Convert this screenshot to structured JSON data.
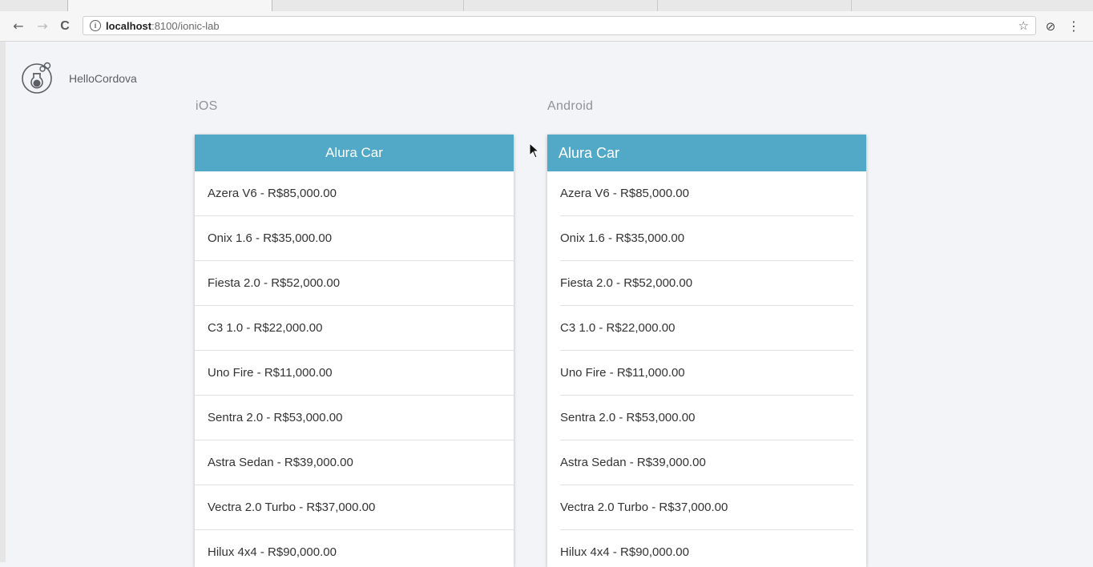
{
  "browser": {
    "back_icon": "←",
    "forward_icon": "→",
    "reload_icon": "C",
    "info_icon": "i",
    "url_host": "localhost",
    "url_path": ":8100/ionic-lab",
    "star_icon": "☆",
    "extension_icon": "⊘",
    "menu_icon": "⋮"
  },
  "app": {
    "name": "HelloCordova"
  },
  "platforms": [
    {
      "label": "iOS",
      "title": "Alura Car",
      "items": [
        "Azera V6 - R$85,000.00",
        "Onix 1.6 - R$35,000.00",
        "Fiesta 2.0 - R$52,000.00",
        "C3 1.0 - R$22,000.00",
        "Uno Fire - R$11,000.00",
        "Sentra 2.0 - R$53,000.00",
        "Astra Sedan - R$39,000.00",
        "Vectra 2.0 Turbo - R$37,000.00",
        "Hilux 4x4 - R$90,000.00"
      ]
    },
    {
      "label": "Android",
      "title": "Alura Car",
      "items": [
        "Azera V6 - R$85,000.00",
        "Onix 1.6 - R$35,000.00",
        "Fiesta 2.0 - R$52,000.00",
        "C3 1.0 - R$22,000.00",
        "Uno Fire - R$11,000.00",
        "Sentra 2.0 - R$53,000.00",
        "Astra Sedan - R$39,000.00",
        "Vectra 2.0 Turbo - R$37,000.00",
        "Hilux 4x4 - R$90,000.00"
      ]
    }
  ],
  "colors": {
    "header": "#51a9c7",
    "background": "#f2f4f8"
  }
}
